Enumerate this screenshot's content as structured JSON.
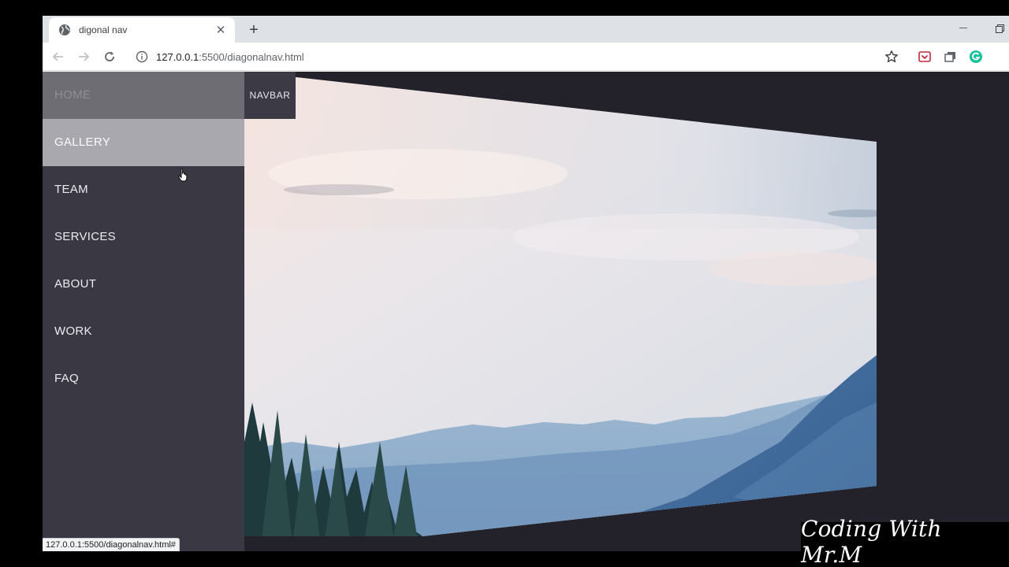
{
  "browser": {
    "tab_title": "digonal nav",
    "url_host": "127.0.0.1",
    "url_rest": ":5500/diagonalnav.html",
    "status_url": "127.0.0.1:5500/diagonalnav.html#",
    "icons": {
      "back": "arrow-left-icon",
      "forward": "arrow-right-icon",
      "reload": "reload-icon",
      "info": "info-icon",
      "star": "star-icon",
      "close": "close-icon",
      "new_tab": "plus-icon"
    }
  },
  "sidebar": {
    "items": [
      {
        "label": "HOME",
        "state": "active"
      },
      {
        "label": "GALLERY",
        "state": "hover"
      },
      {
        "label": "TEAM"
      },
      {
        "label": "SERVICES"
      },
      {
        "label": "ABOUT"
      },
      {
        "label": "WORK"
      },
      {
        "label": "FAQ"
      }
    ]
  },
  "navbar_button": "NAVBAR",
  "watermark": "Coding With Mr.M",
  "colors": {
    "page_bg": "#23222b",
    "sidebar_bg": "#3a3943",
    "active_item": "#6e6d74",
    "hover_item": "#a9a8ae",
    "text": "#ecebf0"
  }
}
